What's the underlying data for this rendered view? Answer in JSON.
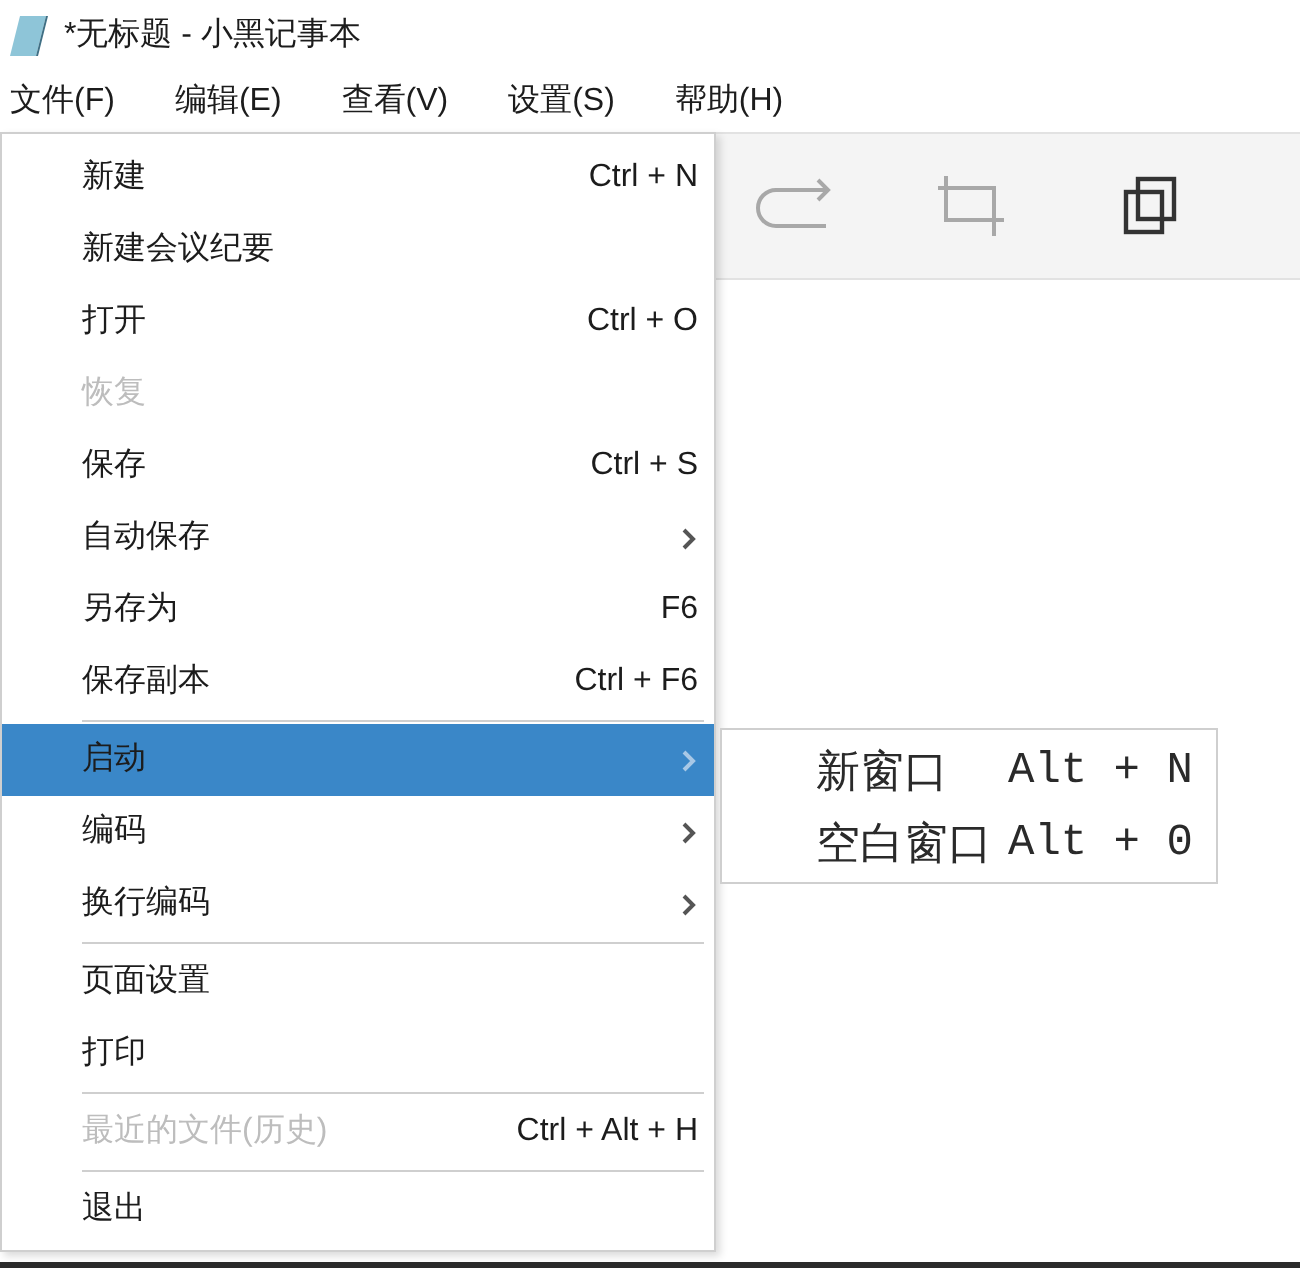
{
  "window": {
    "title": "*无标题 - 小黑记事本"
  },
  "menubar": [
    {
      "label": "文件(F)"
    },
    {
      "label": "编辑(E)"
    },
    {
      "label": "查看(V)"
    },
    {
      "label": "设置(S)"
    },
    {
      "label": "帮助(H)"
    }
  ],
  "toolbar": [
    {
      "kind": "redo",
      "disabled": true
    },
    {
      "kind": "crop",
      "disabled": true
    },
    {
      "kind": "copy",
      "disabled": false
    }
  ],
  "file_menu": {
    "groups": [
      {
        "items": [
          {
            "label": "新建",
            "shortcut": "Ctrl + N",
            "submenu": false,
            "disabled": false,
            "selected": false
          },
          {
            "label": "新建会议纪要",
            "submenu": false,
            "disabled": false,
            "selected": false
          },
          {
            "label": "打开",
            "shortcut": "Ctrl + O",
            "submenu": false,
            "disabled": false,
            "selected": false
          },
          {
            "label": "恢复",
            "submenu": false,
            "disabled": true,
            "selected": false
          },
          {
            "label": "保存",
            "shortcut": "Ctrl + S",
            "submenu": false,
            "disabled": false,
            "selected": false
          },
          {
            "label": "自动保存",
            "submenu": true,
            "disabled": false,
            "selected": false
          },
          {
            "label": "另存为",
            "shortcut": "F6",
            "submenu": false,
            "disabled": false,
            "selected": false
          },
          {
            "label": "保存副本",
            "shortcut": "Ctrl + F6",
            "submenu": false,
            "disabled": false,
            "selected": false
          }
        ]
      },
      {
        "items": [
          {
            "label": "启动",
            "submenu": true,
            "disabled": false,
            "selected": true
          },
          {
            "label": "编码",
            "submenu": true,
            "disabled": false,
            "selected": false
          },
          {
            "label": "换行编码",
            "submenu": true,
            "disabled": false,
            "selected": false
          }
        ]
      },
      {
        "items": [
          {
            "label": "页面设置",
            "submenu": false,
            "disabled": false,
            "selected": false
          },
          {
            "label": "打印",
            "submenu": false,
            "disabled": false,
            "selected": false
          }
        ]
      },
      {
        "items": [
          {
            "label": "最近的文件(历史)",
            "shortcut": "Ctrl + Alt + H",
            "submenu": false,
            "disabled": true,
            "selected": false
          }
        ]
      },
      {
        "items": [
          {
            "label": "退出",
            "submenu": false,
            "disabled": false,
            "selected": false
          }
        ]
      }
    ]
  },
  "submenu": {
    "items": [
      {
        "label": "新窗口",
        "shortcut": "Alt + N"
      },
      {
        "label": "空白窗口",
        "shortcut": "Alt + 0"
      }
    ]
  }
}
